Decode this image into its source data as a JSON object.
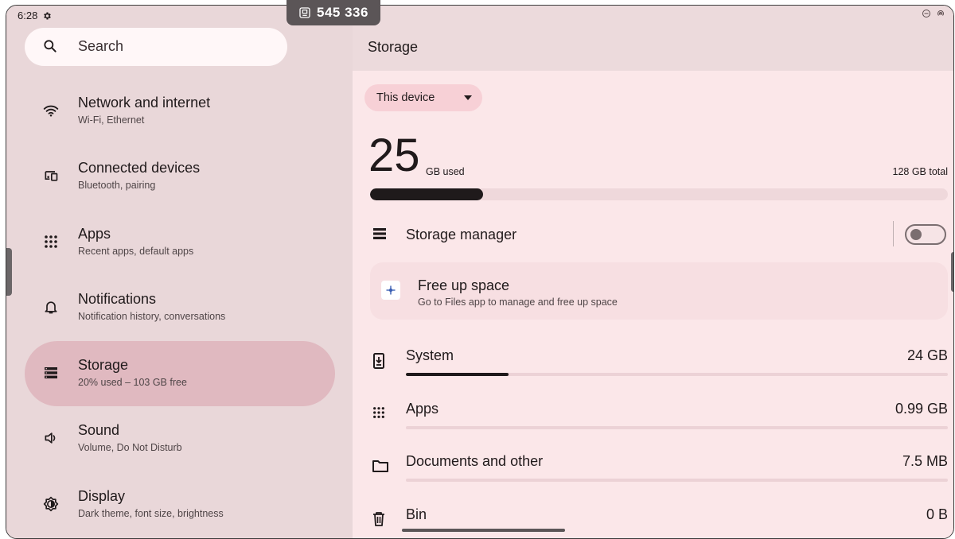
{
  "status_bar": {
    "time": "6:28",
    "code": "545 336"
  },
  "search": {
    "label": "Search"
  },
  "nav": [
    {
      "title": "Network and internet",
      "subtitle": "Wi-Fi, Ethernet",
      "icon": "wifi-icon"
    },
    {
      "title": "Connected devices",
      "subtitle": "Bluetooth, pairing",
      "icon": "devices-icon"
    },
    {
      "title": "Apps",
      "subtitle": "Recent apps, default apps",
      "icon": "apps-grid-icon"
    },
    {
      "title": "Notifications",
      "subtitle": "Notification history, conversations",
      "icon": "bell-icon"
    },
    {
      "title": "Storage",
      "subtitle": "20% used – 103 GB free",
      "icon": "storage-icon",
      "active": true
    },
    {
      "title": "Sound",
      "subtitle": "Volume, Do Not Disturb",
      "icon": "speaker-icon"
    },
    {
      "title": "Display",
      "subtitle": "Dark theme, font size, brightness",
      "icon": "brightness-icon"
    }
  ],
  "storage": {
    "page_title": "Storage",
    "device_selector": "This device",
    "used_value": "25",
    "used_unit": "GB used",
    "total": "128 GB total",
    "used_fraction": 0.195,
    "storage_manager_label": "Storage manager",
    "storage_manager_enabled": false,
    "free_up": {
      "title": "Free up space",
      "subtitle": "Go to Files app to manage and free up space"
    },
    "categories": [
      {
        "name": "System",
        "size": "24 GB",
        "fraction": 0.19,
        "icon": "system-update-icon"
      },
      {
        "name": "Apps",
        "size": "0.99 GB",
        "fraction": 0.0,
        "icon": "apps-grid-icon"
      },
      {
        "name": "Documents and other",
        "size": "7.5 MB",
        "fraction": 0.0,
        "icon": "folder-icon"
      },
      {
        "name": "Bin",
        "size": "0 B",
        "fraction": 0.0,
        "icon": "trash-icon"
      }
    ]
  },
  "colors": {
    "left_bg": "#e9d7d9",
    "right_bg": "#fbe7e9",
    "active_item": "#e0b9c0",
    "accent_dark": "#1f1a1b"
  }
}
